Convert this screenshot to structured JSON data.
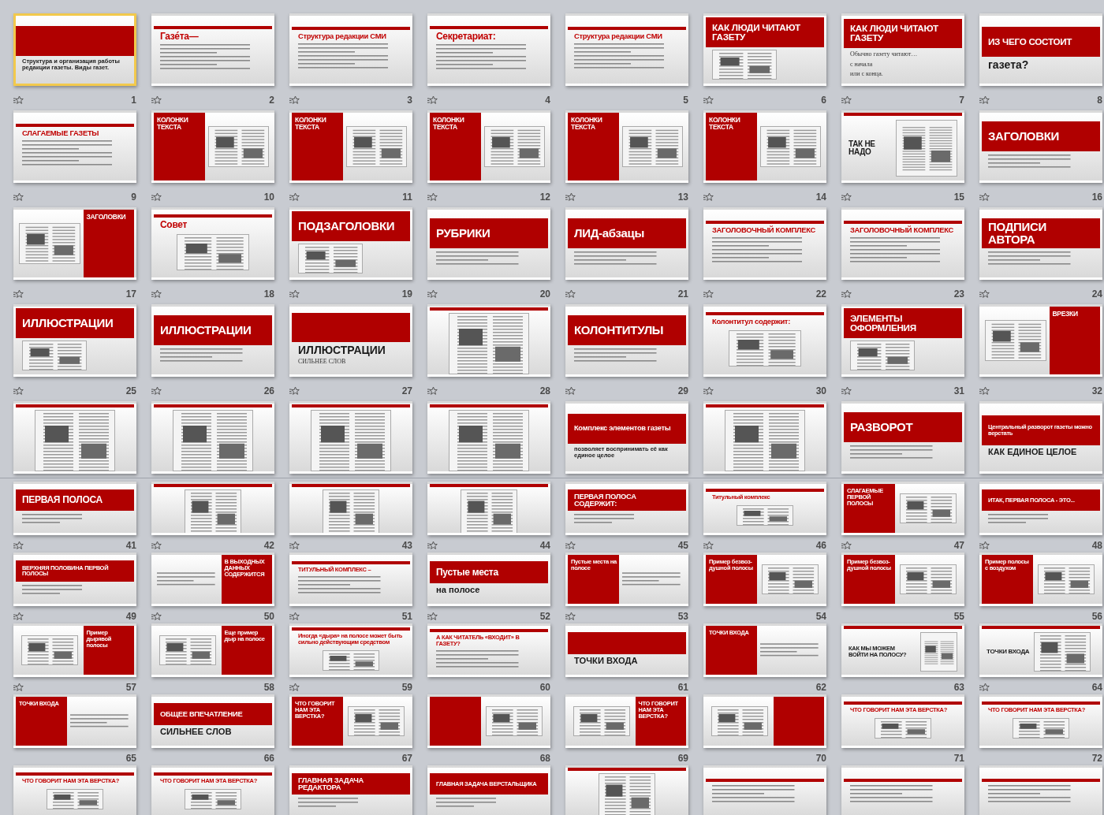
{
  "panes": [
    {
      "slides": [
        {
          "number": "1",
          "kind": "band",
          "subtitle": "Структура и организация работы редакции газеты. Виды газет.",
          "transition": true,
          "selected": true
        },
        {
          "number": "2",
          "kind": "thin",
          "title": "Газе́та—",
          "transition": true,
          "selected": false
        },
        {
          "number": "3",
          "kind": "thin",
          "title": "Структура редакции СМИ",
          "transition": true,
          "selected": false
        },
        {
          "number": "4",
          "kind": "thin",
          "title": "Секретариат:",
          "transition": true,
          "selected": false
        },
        {
          "number": "5",
          "kind": "thin",
          "title": "Структура редакции СМИ",
          "transition": false,
          "selected": false
        },
        {
          "number": "6",
          "kind": "band",
          "title": "КАК ЛЮДИ ЧИТАЮТ ГАЗЕТУ",
          "picture": true,
          "transition": true,
          "selected": false
        },
        {
          "number": "7",
          "kind": "band",
          "title": "КАК ЛЮДИ ЧИТАЮТ ГАЗЕТУ",
          "body": [
            "Обычно газету читают…",
            "с начала",
            "или с конца."
          ],
          "transition": true,
          "selected": false
        },
        {
          "number": "8",
          "kind": "band",
          "title": "ИЗ ЧЕГО СОСТОИТ",
          "subtitle": "газета?",
          "transition": true,
          "selected": false
        },
        {
          "number": "9",
          "kind": "thin",
          "title": "СЛАГАЕМЫЕ ГАЗЕТЫ",
          "transition": true,
          "selected": false
        },
        {
          "number": "10",
          "kind": "left",
          "title": "КОЛОНКИ ТЕКСТА",
          "picture": true,
          "transition": true,
          "selected": false
        },
        {
          "number": "11",
          "kind": "left",
          "title": "КОЛОНКИ ТЕКСТА",
          "picture": true,
          "transition": true,
          "selected": false
        },
        {
          "number": "12",
          "kind": "left",
          "title": "КОЛОНКИ ТЕКСТА",
          "picture": true,
          "transition": true,
          "selected": false
        },
        {
          "number": "13",
          "kind": "left",
          "title": "КОЛОНКИ ТЕКСТА",
          "picture": true,
          "transition": true,
          "selected": false
        },
        {
          "number": "14",
          "kind": "left",
          "title": "КОЛОНКИ ТЕКСТА",
          "picture": true,
          "transition": true,
          "selected": false
        },
        {
          "number": "15",
          "kind": "plain",
          "title": "ТАК НЕ НАДО",
          "picture": true,
          "transition": true,
          "selected": false
        },
        {
          "number": "16",
          "kind": "band",
          "title": "ЗАГОЛОВКИ",
          "transition": true,
          "selected": false
        },
        {
          "number": "17",
          "kind": "right",
          "title": "ЗАГОЛОВКИ",
          "picture": true,
          "transition": true,
          "selected": false
        },
        {
          "number": "18",
          "kind": "thin",
          "title": "Совет",
          "picture": true,
          "transition": true,
          "selected": false
        },
        {
          "number": "19",
          "kind": "band",
          "title": "ПОДЗАГОЛОВКИ",
          "picture": true,
          "transition": true,
          "selected": false
        },
        {
          "number": "20",
          "kind": "band",
          "title": "РУБРИКИ",
          "transition": true,
          "selected": false
        },
        {
          "number": "21",
          "kind": "band",
          "title": "ЛИД-абзацы",
          "transition": true,
          "selected": false
        },
        {
          "number": "22",
          "kind": "thin",
          "title": "ЗАГОЛОВОЧНЫЙ КОМПЛЕКС",
          "transition": true,
          "selected": false
        },
        {
          "number": "23",
          "kind": "thin",
          "title": "ЗАГОЛОВОЧНЫЙ КОМПЛЕКС",
          "transition": true,
          "selected": false
        },
        {
          "number": "24",
          "kind": "band",
          "title": "ПОДПИСИ АВТОРА",
          "transition": true,
          "selected": false
        },
        {
          "number": "25",
          "kind": "band",
          "title": "ИЛЛЮСТРАЦИИ",
          "picture": true,
          "transition": true,
          "selected": false
        },
        {
          "number": "26",
          "kind": "band",
          "title": "ИЛЛЮСТРАЦИИ",
          "transition": true,
          "selected": false
        },
        {
          "number": "27",
          "kind": "band",
          "subtitle": "ИЛЛЮСТРАЦИИ",
          "body": [
            "СИЛЬНЕЕ СЛОВ"
          ],
          "transition": true,
          "selected": false
        },
        {
          "number": "28",
          "kind": "photo",
          "transition": true,
          "selected": false
        },
        {
          "number": "29",
          "kind": "band",
          "title": "КОЛОНТИТУЛЫ",
          "transition": true,
          "selected": false
        },
        {
          "number": "30",
          "kind": "thin",
          "title": "Колонтитул содержит:",
          "picture": true,
          "transition": true,
          "selected": false
        },
        {
          "number": "31",
          "kind": "band",
          "title": "ЭЛЕМЕНТЫ ОФОРМЛЕНИЯ",
          "picture": true,
          "transition": true,
          "selected": false
        },
        {
          "number": "32",
          "kind": "right",
          "title": "ВРЕЗКИ",
          "picture": true,
          "transition": true,
          "selected": false
        },
        {
          "kind": "photo",
          "selected": false
        },
        {
          "kind": "photo",
          "selected": false
        },
        {
          "kind": "photo",
          "selected": false
        },
        {
          "kind": "photo",
          "selected": false
        },
        {
          "kind": "band",
          "title": "Комплекс элементов газеты",
          "subtitle": "позволяет воспринимать её как единое целое",
          "selected": false
        },
        {
          "kind": "photo",
          "selected": false
        },
        {
          "kind": "band",
          "title": "РАЗВОРОТ",
          "selected": false
        },
        {
          "kind": "band",
          "title": "Центральный разворот газеты можно верстать",
          "subtitle": "КАК ЕДИНОЕ ЦЕЛОЕ",
          "selected": false
        }
      ]
    },
    {
      "slides": [
        {
          "number": "41",
          "kind": "band",
          "title": "ПЕРВАЯ ПОЛОСА",
          "transition": true,
          "selected": false
        },
        {
          "number": "42",
          "kind": "photo",
          "transition": true,
          "selected": false
        },
        {
          "number": "43",
          "kind": "photo",
          "transition": true,
          "selected": false
        },
        {
          "number": "44",
          "kind": "photo",
          "transition": true,
          "selected": false
        },
        {
          "number": "45",
          "kind": "band",
          "title": "ПЕРВАЯ ПОЛОСА СОДЕРЖИТ:",
          "transition": true,
          "selected": false
        },
        {
          "number": "46",
          "kind": "thin",
          "title": "Титульный комплекс",
          "picture": true,
          "transition": true,
          "selected": false
        },
        {
          "number": "47",
          "kind": "left",
          "title": "СЛАГАЕМЫЕ ПЕРВОЙ ПОЛОСЫ",
          "picture": true,
          "transition": true,
          "selected": false
        },
        {
          "number": "48",
          "kind": "band",
          "title": "ИТАК, ПЕРВАЯ ПОЛОСА - ЭТО...",
          "transition": true,
          "selected": false
        },
        {
          "number": "49",
          "kind": "band",
          "title": "ВЕРХНЯЯ ПОЛОВИНА ПЕРВОЙ ПОЛОСЫ",
          "transition": true,
          "selected": false
        },
        {
          "number": "50",
          "kind": "right",
          "title": "В ВЫХОДНЫХ ДАННЫХ СОДЕРЖИТСЯ",
          "transition": true,
          "selected": false
        },
        {
          "number": "51",
          "kind": "thin",
          "title": "ТИТУЛЬНЫЙ КОМПЛЕКС –",
          "transition": true,
          "selected": false
        },
        {
          "number": "52",
          "kind": "band",
          "title": "Пустые места",
          "subtitle": "на полосе",
          "transition": true,
          "selected": false
        },
        {
          "number": "53",
          "kind": "left",
          "title": "Пустые места на полосе",
          "transition": true,
          "selected": false
        },
        {
          "number": "54",
          "kind": "left",
          "title": "Пример безвоз-душной полосы",
          "picture": true,
          "transition": false,
          "selected": false
        },
        {
          "number": "55",
          "kind": "left",
          "title": "Пример безвоз-душной полосы",
          "picture": true,
          "transition": false,
          "selected": false
        },
        {
          "number": "56",
          "kind": "left",
          "title": "Пример полосы с воздухом",
          "picture": true,
          "transition": false,
          "selected": false
        },
        {
          "number": "57",
          "kind": "right",
          "title": "Пример дырявой полосы",
          "picture": true,
          "transition": true,
          "selected": false
        },
        {
          "number": "58",
          "kind": "right",
          "title": "Еще пример дыр на полосе",
          "picture": true,
          "transition": false,
          "selected": false
        },
        {
          "number": "59",
          "kind": "thin",
          "title": "Иногда «дыра» на полосе может быть сильно действующим средством",
          "picture": true,
          "transition": true,
          "selected": false
        },
        {
          "number": "60",
          "kind": "thin",
          "title": "А КАК ЧИТАТЕЛЬ «ВХОДИТ» В ГАЗЕТУ?",
          "transition": false,
          "selected": false
        },
        {
          "number": "61",
          "kind": "band",
          "subtitle": "ТОЧКИ ВХОДА",
          "transition": false,
          "selected": false
        },
        {
          "number": "62",
          "kind": "left",
          "title": "ТОЧКИ ВХОДА",
          "transition": false,
          "selected": false
        },
        {
          "number": "63",
          "kind": "plain",
          "title": "КАК МЫ МОЖЕМ ВОЙТИ НА ПОЛОСУ?",
          "picture": true,
          "transition": false,
          "selected": false
        },
        {
          "number": "64",
          "kind": "plain",
          "title": "ТОЧКИ ВХОДА",
          "picture": true,
          "transition": true,
          "selected": false
        },
        {
          "number": "65",
          "kind": "left",
          "title": "ТОЧКИ ВХОДА",
          "transition": false,
          "selected": false
        },
        {
          "number": "66",
          "kind": "band",
          "title": "ОБЩЕЕ ВПЕЧАТЛЕНИЕ",
          "subtitle": "СИЛЬНЕЕ СЛОВ",
          "transition": false,
          "selected": false
        },
        {
          "number": "67",
          "kind": "left",
          "title": "ЧТО ГОВОРИТ НАМ ЭТА ВЕРСТКА?",
          "picture": true,
          "transition": false,
          "selected": false
        },
        {
          "number": "68",
          "kind": "left",
          "picture": true,
          "transition": false,
          "selected": false
        },
        {
          "number": "69",
          "kind": "right",
          "title": "ЧТО ГОВОРИТ НАМ ЭТА ВЕРСТКА?",
          "picture": true,
          "transition": false,
          "selected": false
        },
        {
          "number": "70",
          "kind": "right",
          "picture": true,
          "transition": false,
          "selected": false
        },
        {
          "number": "71",
          "kind": "thin",
          "title": "ЧТО ГОВОРИТ НАМ ЭТА ВЕРСТКА?",
          "picture": true,
          "transition": false,
          "selected": false
        },
        {
          "number": "72",
          "kind": "thin",
          "title": "ЧТО ГОВОРИТ НАМ ЭТА ВЕРСТКА?",
          "picture": true,
          "transition": false,
          "selected": false
        },
        {
          "kind": "thin",
          "title": "ЧТО ГОВОРИТ НАМ ЭТА ВЕРСТКА?",
          "picture": true,
          "selected": false
        },
        {
          "kind": "thin",
          "title": "ЧТО ГОВОРИТ НАМ ЭТА ВЕРСТКА?",
          "picture": true,
          "selected": false
        },
        {
          "kind": "band",
          "title": "ГЛАВНАЯ ЗАДАЧА РЕДАКТОРА",
          "selected": false
        },
        {
          "kind": "band",
          "title": "ГЛАВНАЯ ЗАДАЧА ВЕРСТАЛЬЩИКА",
          "selected": false
        },
        {
          "kind": "photo",
          "selected": false
        },
        {
          "kind": "thin",
          "selected": false
        },
        {
          "kind": "thin",
          "selected": false
        },
        {
          "kind": "thin",
          "selected": false
        }
      ]
    }
  ]
}
